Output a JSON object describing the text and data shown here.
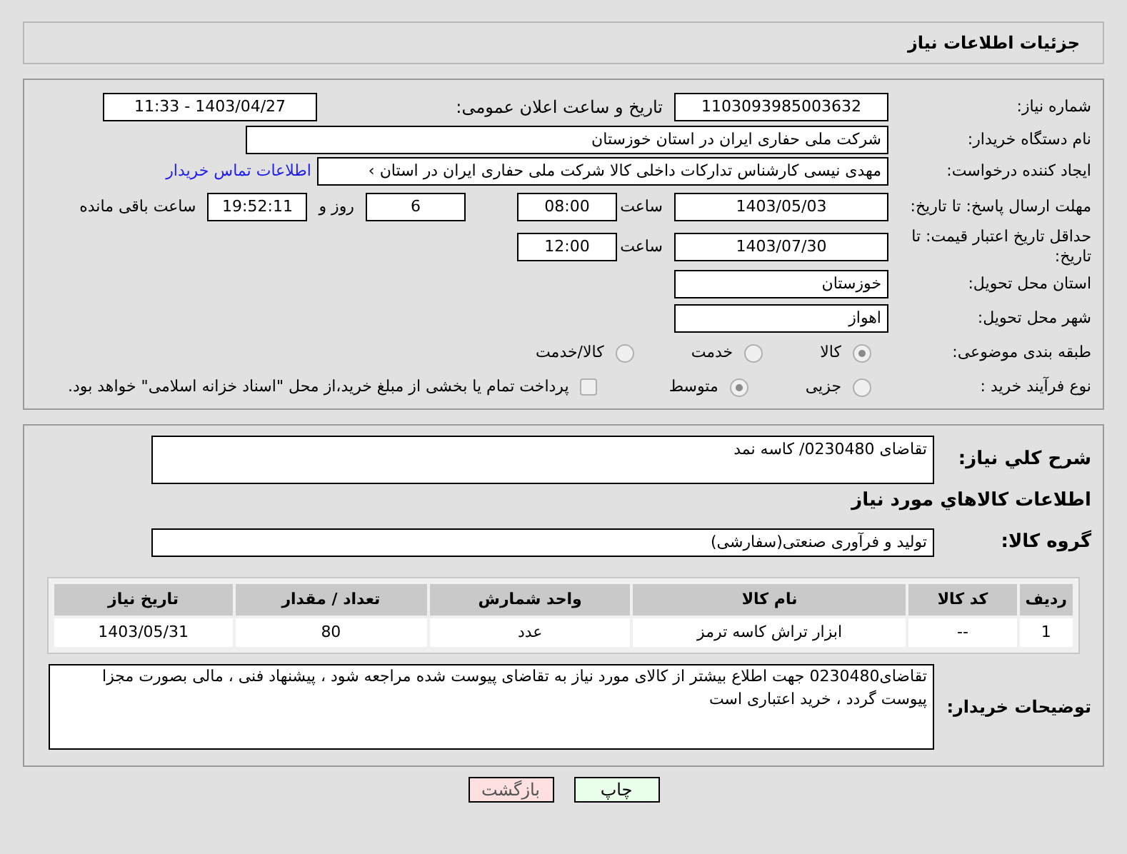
{
  "header": {
    "title": "جزئیات اطلاعات نیاز"
  },
  "need_number": {
    "label": "شماره نیاز:",
    "value": "1103093985003632"
  },
  "announce": {
    "label": "تاریخ و ساعت اعلان عمومی:",
    "value": "1403/04/27 - 11:33"
  },
  "buyer_org": {
    "label": "نام دستگاه خریدار:",
    "value": "شرکت ملی حفاری ایران در استان خوزستان"
  },
  "creator": {
    "label": "ایجاد کننده درخواست:",
    "value": "مهدی نیسی کارشناس تدارکات داخلی کالا شرکت ملی حفاری ایران در استان ›",
    "link": "اطلاعات تماس خریدار"
  },
  "deadline": {
    "label": "مهلت ارسال پاسخ: تا تاریخ:",
    "date": "1403/05/03",
    "time_label": "ساعت",
    "time": "08:00",
    "days": "6",
    "days_label": "روز و",
    "remaining": "19:52:11",
    "remaining_label": "ساعت باقی مانده"
  },
  "validity": {
    "label": "حداقل تاریخ اعتبار قیمت: تا تاریخ:",
    "date": "1403/07/30",
    "time_label": "ساعت",
    "time": "12:00"
  },
  "province": {
    "label": "استان محل تحویل:",
    "value": "خوزستان"
  },
  "city": {
    "label": "شهر محل تحویل:",
    "value": "اهواز"
  },
  "category": {
    "label": "طبقه بندی موضوعی:",
    "options": [
      {
        "label": "کالا",
        "selected": true
      },
      {
        "label": "خدمت",
        "selected": false
      },
      {
        "label": "کالا/خدمت",
        "selected": false
      }
    ]
  },
  "process": {
    "label": "نوع فرآیند خرید :",
    "options": [
      {
        "label": "جزیی",
        "selected": false
      },
      {
        "label": "متوسط",
        "selected": true
      }
    ],
    "payment": {
      "label": "پرداخت تمام یا بخشی از مبلغ خرید،از محل \"اسناد خزانه اسلامی\" خواهد بود.",
      "checked": false
    }
  },
  "description": {
    "label": "شرح کلي نياز:",
    "value": "تقاضای 0230480/  کاسه نمد"
  },
  "goods_heading": "اطلاعات كالاهاي مورد نياز",
  "goods_group": {
    "label": "گروه کالا:",
    "value": "تولید و فرآوری صنعتی(سفارشی)"
  },
  "table": {
    "columns": [
      "ردیف",
      "کد کالا",
      "نام کالا",
      "واحد شمارش",
      "تعداد / مقدار",
      "تاریخ نیاز"
    ],
    "rows": [
      [
        "1",
        "--",
        "ابزار تراش کاسه ترمز",
        "عدد",
        "80",
        "1403/05/31"
      ]
    ]
  },
  "buyer_notes": {
    "label": "توضیحات خریدار:",
    "value": "تقاضای0230480 جهت اطلاع بیشتر از کالای مورد نیاز به تقاضای پیوست شده مراجعه شود ، پیشنهاد فنی ، مالی بصورت مجزا پیوست گردد ، خرید اعتباری است"
  },
  "buttons": [
    {
      "label": "چاپ",
      "kind": "print"
    },
    {
      "label": "بازگشت",
      "kind": "back"
    }
  ]
}
